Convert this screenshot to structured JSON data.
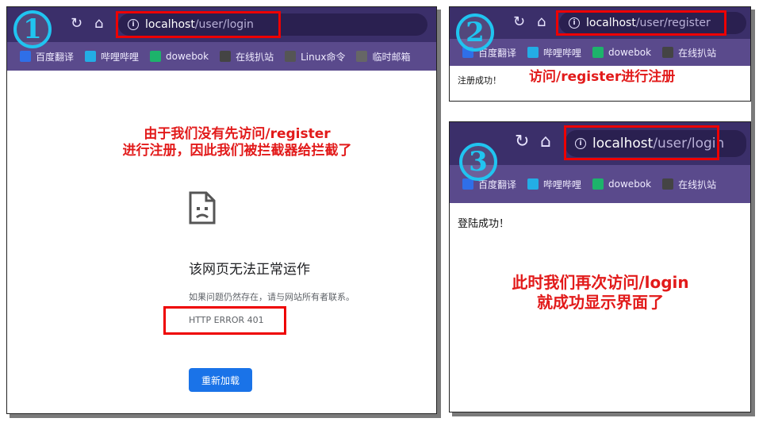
{
  "panel1": {
    "url_host": "localhost",
    "url_path": "/user/login",
    "bookmarks": [
      {
        "label": "百度翻译",
        "icon": "baidu-translate-icon",
        "color": "#2f6fe8"
      },
      {
        "label": "哔哩哔哩",
        "icon": "bilibili-icon",
        "color": "#23ade5"
      },
      {
        "label": "dowebok",
        "icon": "dowebok-icon",
        "color": "#1db36b"
      },
      {
        "label": "在线扒站",
        "icon": "spider-icon",
        "color": "#444444"
      },
      {
        "label": "Linux命令",
        "icon": "linux-icon",
        "color": "#555555"
      },
      {
        "label": "临时邮箱",
        "icon": "mail-icon",
        "color": "#666666"
      }
    ],
    "annotation_line1": "由于我们没有先访问/register",
    "annotation_line2": "进行注册，因此我们被拦截器给拦截了",
    "error_title": "该网页无法正常运作",
    "error_sub": "如果问题仍然存在，请与网站所有者联系。",
    "error_code": "HTTP ERROR 401",
    "reload_label": "重新加载",
    "number": "1"
  },
  "panel2": {
    "url_host": "localhost",
    "url_path": "/user/register",
    "bookmarks": [
      {
        "label": "百度翻译",
        "icon": "baidu-translate-icon",
        "color": "#2f6fe8"
      },
      {
        "label": "哔哩哔哩",
        "icon": "bilibili-icon",
        "color": "#23ade5"
      },
      {
        "label": "dowebok",
        "icon": "dowebok-icon",
        "color": "#1db36b"
      },
      {
        "label": "在线扒站",
        "icon": "spider-icon",
        "color": "#444444"
      }
    ],
    "page_text": "注册成功！",
    "annotation": "访问/register进行注册",
    "number": "2"
  },
  "panel3": {
    "url_host": "localhost",
    "url_path": "/user/login",
    "bookmarks": [
      {
        "label": "百度翻译",
        "icon": "baidu-translate-icon",
        "color": "#2f6fe8"
      },
      {
        "label": "哔哩哔哩",
        "icon": "bilibili-icon",
        "color": "#23ade5"
      },
      {
        "label": "dowebok",
        "icon": "dowebok-icon",
        "color": "#1db36b"
      },
      {
        "label": "在线扒站",
        "icon": "spider-icon",
        "color": "#444444"
      }
    ],
    "page_text": "登陆成功！",
    "annotation_line1": "此时我们再次访问/login",
    "annotation_line2": "就成功显示界面了",
    "number": "3"
  }
}
